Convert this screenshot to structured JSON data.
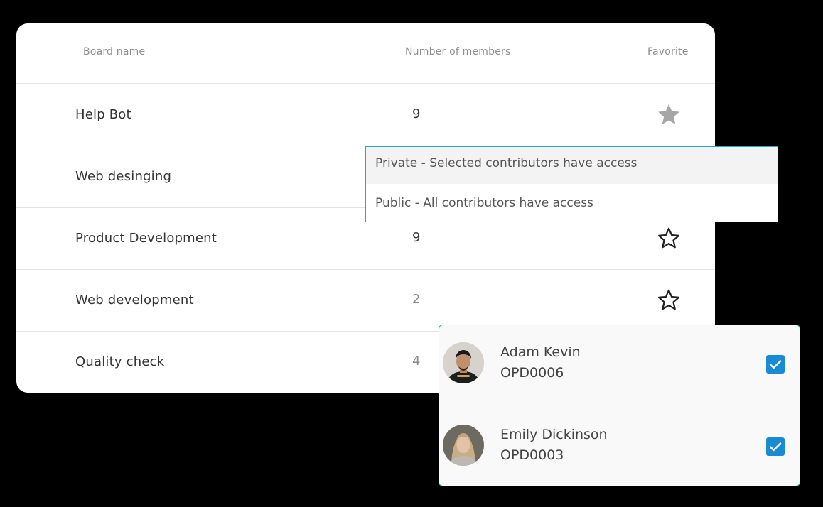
{
  "table": {
    "headers": {
      "name": "Board name",
      "members": "Number of members",
      "favorite": "Favorite"
    },
    "rows": [
      {
        "name": "Help Bot",
        "members": "9",
        "favorite": "filled-gray"
      },
      {
        "name": "Web desinging",
        "members": "",
        "favorite": "hidden"
      },
      {
        "name": "Product Development",
        "members": "9",
        "favorite": "outline"
      },
      {
        "name": "Web development",
        "members": "2",
        "favorite": "outline"
      },
      {
        "name": "Quality check",
        "members": "4",
        "favorite": "hidden"
      }
    ]
  },
  "access_dropdown": {
    "options": [
      {
        "label": "Private - Selected contributors have access",
        "highlighted": true
      },
      {
        "label": "Public - All contributors have access",
        "highlighted": false
      }
    ]
  },
  "members_panel": {
    "members": [
      {
        "name": "Adam Kevin",
        "id": "OPD0006",
        "checked": true,
        "avatar": "man-avatar"
      },
      {
        "name": "Emily Dickinson",
        "id": "OPD0003",
        "checked": true,
        "avatar": "woman-avatar"
      }
    ]
  },
  "colors": {
    "accent_border": "#2aa4c4",
    "checkbox": "#1a8ad3",
    "star_filled": "#a6a6a6",
    "background": "#000000"
  }
}
